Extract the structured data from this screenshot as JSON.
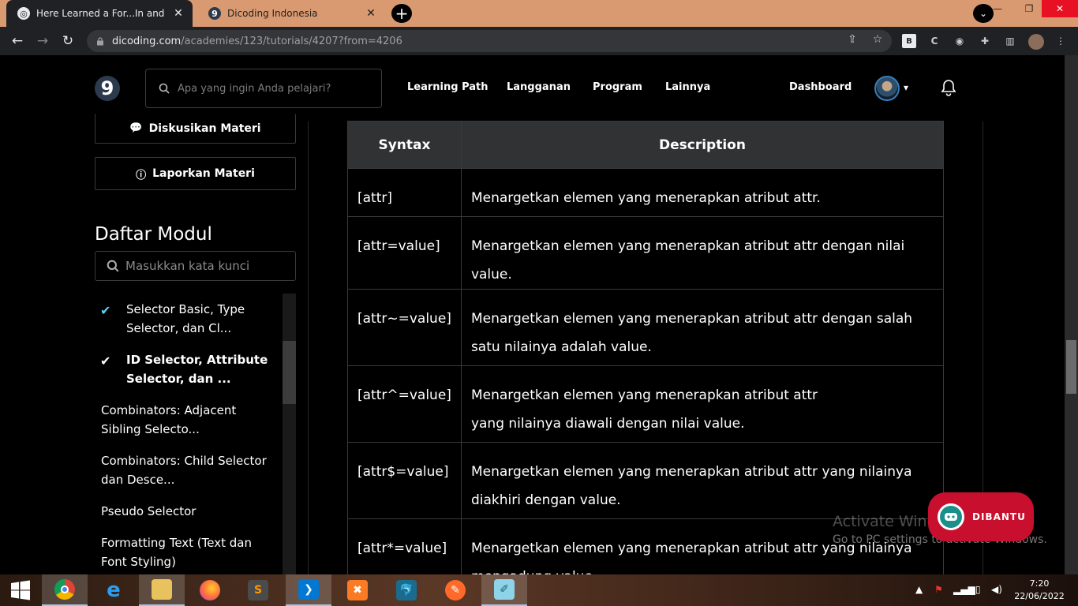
{
  "browser": {
    "tabs": [
      {
        "title": "Here Learned a For...In and For...c",
        "active": true
      },
      {
        "title": "Dicoding Indonesia",
        "active": false
      }
    ],
    "url_host": "dicoding.com",
    "url_path": "/academies/123/tutorials/4207?from=4206",
    "extensions": [
      "B",
      "C",
      "bookmarks",
      "puzzle",
      "sidebar"
    ]
  },
  "header": {
    "search_placeholder": "Apa yang ingin Anda pelajari?",
    "nav": [
      "Learning Path",
      "Langganan",
      "Program",
      "Lainnya"
    ],
    "dashboard": "Dashboard"
  },
  "sidebar": {
    "discuss_btn": "Diskusikan Materi",
    "report_btn": "Laporkan Materi",
    "title": "Daftar Modul",
    "search_placeholder": "Masukkan kata kunci",
    "modules": [
      {
        "label": "Selector Basic, Type Selector, dan Cl...",
        "done": true,
        "current": false
      },
      {
        "label": "ID Selector, Attribute Selector, dan ...",
        "done": true,
        "current": true
      },
      {
        "label": "Combinators: Adjacent Sibling Selecto...",
        "done": false,
        "current": false
      },
      {
        "label": "Combinators: Child Selector dan Desce...",
        "done": false,
        "current": false
      },
      {
        "label": "Pseudo Selector",
        "done": false,
        "current": false
      },
      {
        "label": "Formatting Text (Text dan Font Styling)",
        "done": false,
        "current": false
      }
    ]
  },
  "table": {
    "headers": [
      "Syntax",
      "Description"
    ],
    "rows": [
      {
        "syntax": "[attr]",
        "desc": "Menargetkan elemen yang menerapkan atribut attr."
      },
      {
        "syntax": "[attr=value]",
        "desc": "Menargetkan elemen yang menerapkan atribut attr dengan nilai value."
      },
      {
        "syntax": "[attr~=value]",
        "desc": "Menargetkan elemen yang menerapkan atribut attr dengan salah satu nilainya adalah value."
      },
      {
        "syntax": "[attr^=value]",
        "desc": "Menargetkan elemen yang menerapkan atribut attr yang nilainya diawali dengan nilai value."
      },
      {
        "syntax": "[attr$=value]",
        "desc": "Menargetkan elemen yang menerapkan atribut attr yang nilainya diakhiri dengan value."
      },
      {
        "syntax": "[attr*=value]",
        "desc": "Menargetkan elemen yang menerapkan atribut attr yang nilainya mengadung value."
      }
    ]
  },
  "dibantu": "DIBANTU",
  "watermark": {
    "line1": "Activate Windows",
    "line2": "Go to PC settings to activate Windows."
  },
  "taskbar": {
    "apps": [
      "chrome",
      "internet-explorer",
      "file-explorer",
      "firefox",
      "sublime-text",
      "vscode",
      "xampp",
      "mysql-workbench",
      "pencil",
      "notepad"
    ],
    "time": "7:20",
    "date": "22/06/2022"
  },
  "colors": {
    "accent_check": "#5fd0f0",
    "dibantu": "#c8102e",
    "tab_strip": "#d99a72"
  }
}
